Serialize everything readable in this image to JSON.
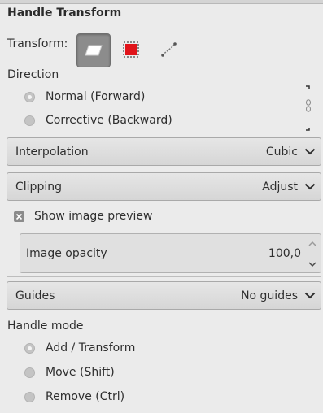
{
  "title": "Handle Transform",
  "transform": {
    "label": "Transform:",
    "buttons": [
      {
        "icon": "transform-layer-icon",
        "active": true
      },
      {
        "icon": "transform-selection-icon",
        "color": "#e0141a"
      },
      {
        "icon": "transform-path-icon"
      }
    ]
  },
  "direction": {
    "label": "Direction",
    "options": [
      "Normal (Forward)",
      "Corrective (Backward)"
    ],
    "selected": 0
  },
  "interpolation": {
    "label": "Interpolation",
    "value": "Cubic"
  },
  "clipping": {
    "label": "Clipping",
    "value": "Adjust"
  },
  "preview": {
    "label": "Show image preview",
    "checked": true
  },
  "opacity": {
    "label": "Image opacity",
    "value": "100,0"
  },
  "guides": {
    "label": "Guides",
    "value": "No guides"
  },
  "handle_mode": {
    "label": "Handle mode",
    "options": [
      "Add / Transform",
      "Move (Shift)",
      "Remove (Ctrl)"
    ],
    "selected": 0
  }
}
